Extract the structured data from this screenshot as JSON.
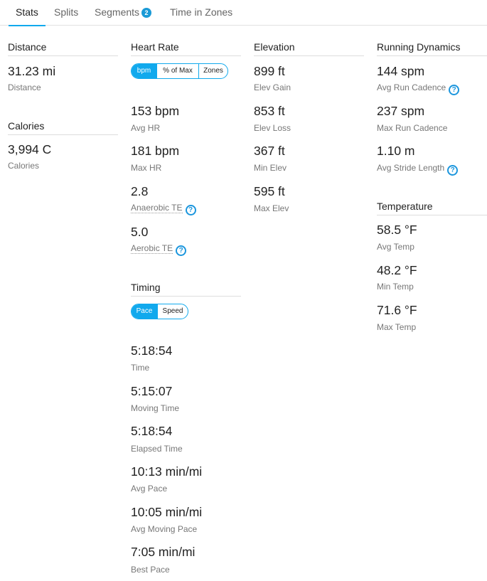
{
  "tabs": [
    {
      "label": "Stats"
    },
    {
      "label": "Splits"
    },
    {
      "label": "Segments",
      "badge": "2"
    },
    {
      "label": "Time in Zones"
    }
  ],
  "distance": {
    "title": "Distance",
    "value": "31.23 mi",
    "label": "Distance"
  },
  "calories": {
    "title": "Calories",
    "value": "3,994 C",
    "label": "Calories"
  },
  "heart_rate": {
    "title": "Heart Rate",
    "toggle": [
      "bpm",
      "% of Max",
      "Zones"
    ],
    "stats": [
      {
        "value": "153 bpm",
        "label": "Avg HR"
      },
      {
        "value": "181 bpm",
        "label": "Max HR"
      },
      {
        "value": "2.8",
        "label": "Anaerobic TE"
      },
      {
        "value": "5.0",
        "label": "Aerobic TE"
      }
    ]
  },
  "timing": {
    "title": "Timing",
    "toggle": [
      "Pace",
      "Speed"
    ],
    "stats": [
      {
        "value": "5:18:54",
        "label": "Time"
      },
      {
        "value": "5:15:07",
        "label": "Moving Time"
      },
      {
        "value": "5:18:54",
        "label": "Elapsed Time"
      },
      {
        "value": "10:13 min/mi",
        "label": "Avg Pace"
      },
      {
        "value": "10:05 min/mi",
        "label": "Avg Moving Pace"
      },
      {
        "value": "7:05 min/mi",
        "label": "Best Pace"
      }
    ]
  },
  "elevation": {
    "title": "Elevation",
    "stats": [
      {
        "value": "899 ft",
        "label": "Elev Gain"
      },
      {
        "value": "853 ft",
        "label": "Elev Loss"
      },
      {
        "value": "367 ft",
        "label": "Min Elev"
      },
      {
        "value": "595 ft",
        "label": "Max Elev"
      }
    ]
  },
  "running_dynamics": {
    "title": "Running Dynamics",
    "stats": [
      {
        "value": "144 spm",
        "label": "Avg Run Cadence"
      },
      {
        "value": "237 spm",
        "label": "Max Run Cadence"
      },
      {
        "value": "1.10 m",
        "label": "Avg Stride Length"
      }
    ]
  },
  "temperature": {
    "title": "Temperature",
    "stats": [
      {
        "value": "58.5 °F",
        "label": "Avg Temp"
      },
      {
        "value": "48.2 °F",
        "label": "Min Temp"
      },
      {
        "value": "71.6 °F",
        "label": "Max Temp"
      }
    ]
  },
  "help_icon_glyph": "?",
  "colors": {
    "accent": "#11a9ed",
    "badge": "#1a9ad6"
  }
}
